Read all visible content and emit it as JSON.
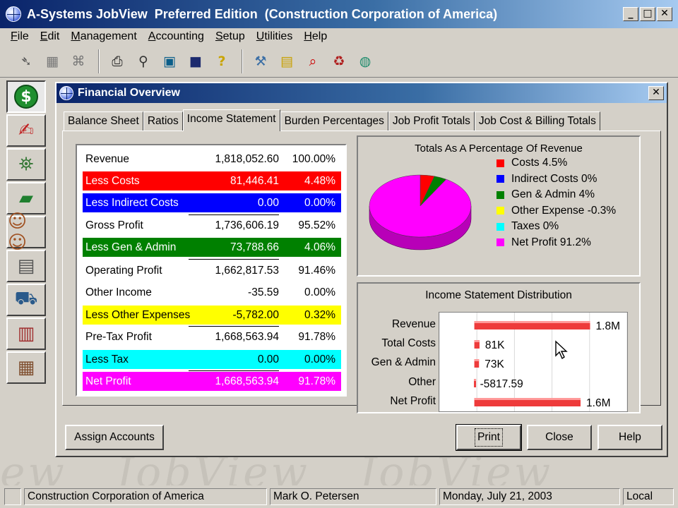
{
  "window": {
    "title": "A-Systems JobView  Preferred Edition  (Construction Corporation of America)",
    "minimize_glyph": "_",
    "maximize_glyph": "□",
    "close_glyph": "✕"
  },
  "menu": [
    "File",
    "Edit",
    "Management",
    "Accounting",
    "Setup",
    "Utilities",
    "Help"
  ],
  "toolbar": {
    "icons": [
      "pointer-icon",
      "grid-icon",
      "network-icon",
      "printer-icon",
      "find-icon",
      "monitor-icon",
      "save-icon",
      "help-icon",
      "tools-icon",
      "document-icon",
      "search-icon",
      "trash-icon",
      "globe-icon"
    ]
  },
  "sidebar": {
    "icons": [
      "financial-icon",
      "edit-document-icon",
      "satellite-icon",
      "money-icon",
      "people-icon",
      "forms-icon",
      "equipment-icon",
      "purchase-order-icon",
      "calculator-icon"
    ]
  },
  "watermark": "ew   JobView   JobView",
  "child": {
    "title": "Financial Overview",
    "close_glyph": "✕",
    "tabs": [
      "Balance Sheet",
      "Ratios",
      "Income Statement",
      "Burden Percentages",
      "Job Profit Totals",
      "Job Cost & Billing Totals"
    ],
    "active_tab": "Income Statement"
  },
  "income_statement": [
    {
      "label": "Revenue",
      "amount": "1,818,052.60",
      "pct": "100.00%",
      "bg": "#ffffff",
      "fg": "#000000"
    },
    {
      "label": "Less Costs",
      "amount": "81,446.41",
      "pct": "4.48%",
      "bg": "#ff0000",
      "fg": "#ffffff"
    },
    {
      "label": "Less Indirect Costs",
      "amount": "0.00",
      "pct": "0.00%",
      "bg": "#0000ff",
      "fg": "#ffffff"
    },
    {
      "label": "Gross Profit",
      "amount": "1,736,606.19",
      "pct": "95.52%",
      "bg": "#ffffff",
      "fg": "#000000"
    },
    {
      "label": "Less Gen & Admin",
      "amount": "73,788.66",
      "pct": "4.06%",
      "bg": "#008000",
      "fg": "#ffffff"
    },
    {
      "label": "Operating Profit",
      "amount": "1,662,817.53",
      "pct": "91.46%",
      "bg": "#ffffff",
      "fg": "#000000"
    },
    {
      "label": "Other Income",
      "amount": "-35.59",
      "pct": "0.00%",
      "bg": "#ffffff",
      "fg": "#000000"
    },
    {
      "label": "Less Other Expenses",
      "amount": "-5,782.00",
      "pct": "0.32%",
      "bg": "#ffff00",
      "fg": "#000000"
    },
    {
      "label": "Pre-Tax Profit",
      "amount": "1,668,563.94",
      "pct": "91.78%",
      "bg": "#ffffff",
      "fg": "#000000"
    },
    {
      "label": "Less Tax",
      "amount": "0.00",
      "pct": "0.00%",
      "bg": "#00ffff",
      "fg": "#000000"
    },
    {
      "label": "Net Profit",
      "amount": "1,668,563.94",
      "pct": "91.78%",
      "bg": "#ff00ff",
      "fg": "#ffffff"
    }
  ],
  "pie": {
    "title": "Totals As A Percentage Of Revenue",
    "legend": [
      {
        "label": "Costs 4.5%",
        "color": "#ff0000"
      },
      {
        "label": "Indirect Costs 0%",
        "color": "#0000ff"
      },
      {
        "label": "Gen & Admin 4%",
        "color": "#008000"
      },
      {
        "label": "Other Expense -0.3%",
        "color": "#ffff00"
      },
      {
        "label": "Taxes 0%",
        "color": "#00ffff"
      },
      {
        "label": "Net Profit 91.2%",
        "color": "#ff00ff"
      }
    ]
  },
  "chart_data": [
    {
      "type": "pie",
      "title": "Totals As A Percentage Of Revenue",
      "categories": [
        "Costs",
        "Indirect Costs",
        "Gen & Admin",
        "Other Expense",
        "Taxes",
        "Net Profit"
      ],
      "values": [
        4.5,
        0,
        4,
        -0.3,
        0,
        91.2
      ]
    },
    {
      "type": "bar",
      "orientation": "horizontal",
      "title": "Income Statement Distribution",
      "categories": [
        "Revenue",
        "Total Costs",
        "Gen & Admin",
        "Other",
        "Net Profit"
      ],
      "values": [
        1818052.6,
        81446.41,
        73788.66,
        -5817.59,
        1668563.94
      ],
      "data_labels": [
        "1.8M",
        "81K",
        "73K",
        "-5817.59",
        "1.6M"
      ],
      "xlim": [
        -550000,
        2400000
      ],
      "grid": true
    }
  ],
  "buttons": {
    "assign": "Assign Accounts",
    "print": "Print",
    "close": "Close",
    "help": "Help"
  },
  "status": {
    "company": "Construction Corporation of America",
    "user": "Mark O. Petersen",
    "date": "Monday, July 21, 2003",
    "mode": "Local"
  }
}
